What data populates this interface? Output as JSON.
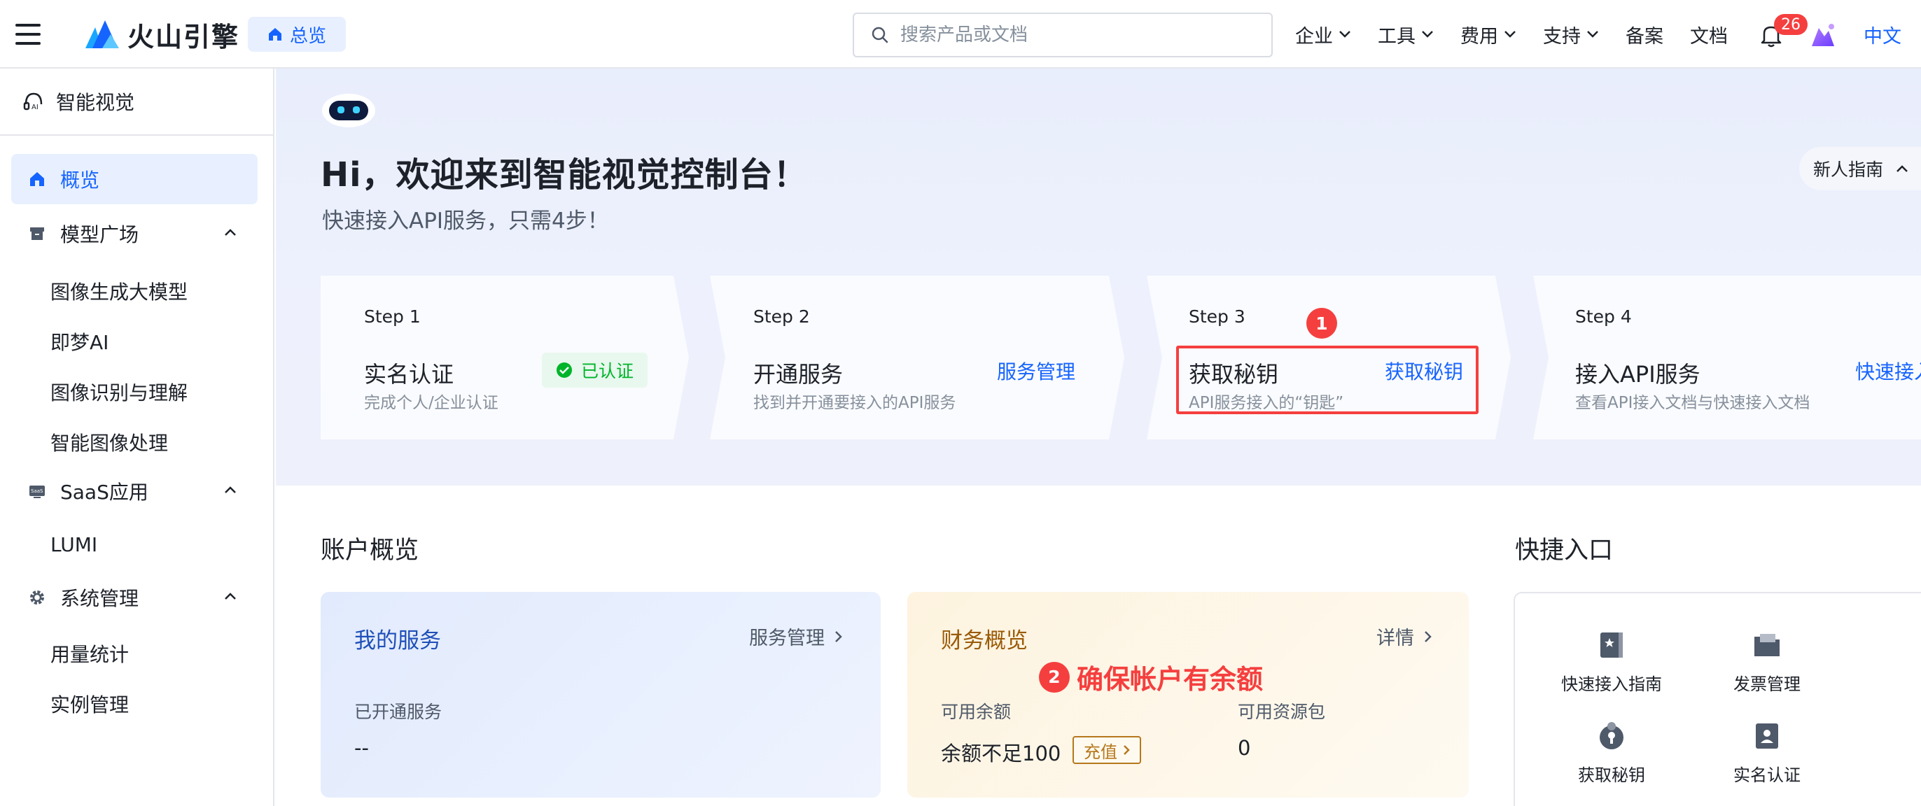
{
  "brand": {
    "name": "火山引擎",
    "home_label": "总览"
  },
  "search": {
    "placeholder": "搜索产品或文档"
  },
  "nav": {
    "items": [
      {
        "label": "企业",
        "has_dropdown": true
      },
      {
        "label": "工具",
        "has_dropdown": true
      },
      {
        "label": "费用",
        "has_dropdown": true
      },
      {
        "label": "支持",
        "has_dropdown": true
      },
      {
        "label": "备案",
        "has_dropdown": false
      },
      {
        "label": "文档",
        "has_dropdown": false
      }
    ],
    "notification_count": "26",
    "language": "中文"
  },
  "sidebar": {
    "product": "智能视觉",
    "overview": "概览",
    "groups": [
      {
        "label": "模型广场",
        "items": [
          "图像生成大模型",
          "即梦AI",
          "图像识别与理解",
          "智能图像处理"
        ]
      },
      {
        "label": "SaaS应用",
        "items": [
          "LUMI"
        ]
      },
      {
        "label": "系统管理",
        "items": [
          "用量统计",
          "实例管理"
        ]
      }
    ]
  },
  "hero": {
    "title": "Hi，欢迎来到智能视觉控制台！",
    "subtitle": "快速接入API服务，只需4步！",
    "guide_button": "新人指南"
  },
  "steps": [
    {
      "label": "Step 1",
      "title": "实名认证",
      "desc": "完成个人/企业认证",
      "status": "已认证"
    },
    {
      "label": "Step 2",
      "title": "开通服务",
      "desc": "找到并开通要接入的API服务",
      "link": "服务管理"
    },
    {
      "label": "Step 3",
      "title": "获取秘钥",
      "desc": "API服务接入的“钥匙”",
      "link": "获取秘钥"
    },
    {
      "label": "Step 4",
      "title": "接入API服务",
      "desc": "查看API接入文档与快速接入文档",
      "link": "快速接入"
    }
  ],
  "annotations": {
    "badge1": "1",
    "badge2": "2",
    "note2": "确保帐户有余额"
  },
  "account": {
    "section_title": "账户概览",
    "services": {
      "title": "我的服务",
      "link": "服务管理",
      "label": "已开通服务",
      "value": "--"
    },
    "finance": {
      "title": "财务概览",
      "link": "详情",
      "balance_label": "可用余额",
      "balance_value": "余额不足100",
      "recharge": "充值",
      "package_label": "可用资源包",
      "package_value": "0"
    }
  },
  "quick": {
    "section_title": "快捷入口",
    "items": [
      "快速接入指南",
      "发票管理",
      "获取秘钥",
      "实名认证"
    ]
  },
  "colors": {
    "primary": "#1664ff",
    "danger": "#f53f3f",
    "success": "#00b42a",
    "finance_title": "#9a5a06",
    "services_title": "#1f4fb8"
  }
}
